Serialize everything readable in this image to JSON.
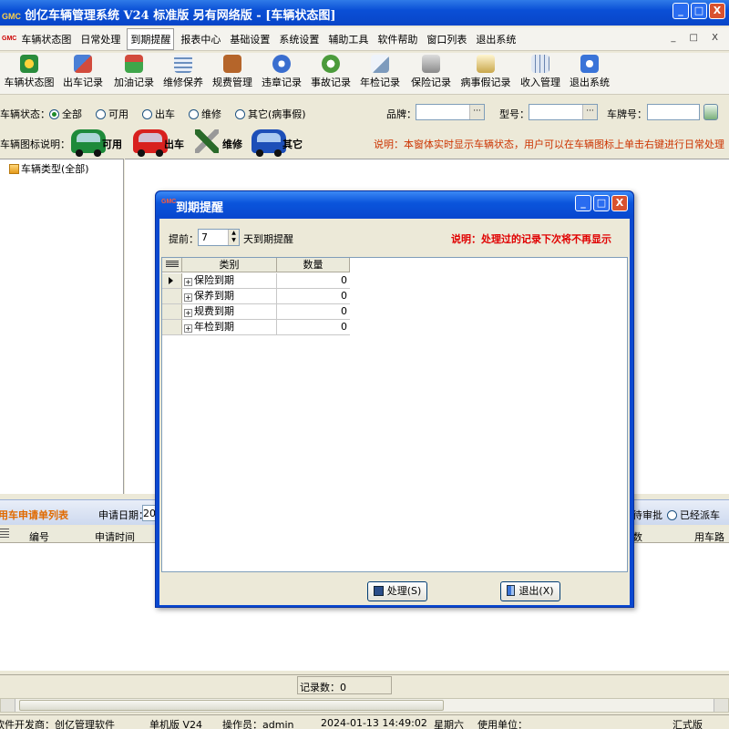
{
  "window": {
    "brand": "GMC",
    "title": "创亿车辆管理系统 V24 标准版 另有网络版 - [车辆状态图]",
    "controls": {
      "minimize": "_",
      "maximize": "□",
      "close": "X"
    }
  },
  "menu": {
    "items": [
      "车辆状态图",
      "日常处理",
      "到期提醒",
      "报表中心",
      "基础设置",
      "系统设置",
      "辅助工具",
      "软件帮助",
      "窗口列表",
      "退出系统"
    ],
    "active": "到期提醒",
    "mdi_controls": "_ □ X"
  },
  "toolbar": {
    "items": [
      {
        "label": "车辆状态图",
        "icon": "car-status-icon",
        "color": "#2a8c3c"
      },
      {
        "label": "出车记录",
        "icon": "dispatch-icon",
        "color": "#4a7fd6"
      },
      {
        "label": "加油记录",
        "icon": "fuel-icon",
        "color": "#d24b3c"
      },
      {
        "label": "维修保养",
        "icon": "maintenance-icon",
        "color": "#6b8fbf"
      },
      {
        "label": "规费管理",
        "icon": "fee-icon",
        "color": "#b5652a"
      },
      {
        "label": "违章记录",
        "icon": "violation-icon",
        "color": "#3a6ecf"
      },
      {
        "label": "事故记录",
        "icon": "accident-icon",
        "color": "#4b9b3b"
      },
      {
        "label": "年检记录",
        "icon": "inspection-icon",
        "color": "#7d9bbd"
      },
      {
        "label": "保险记录",
        "icon": "insurance-icon",
        "color": "#8a8a8a"
      },
      {
        "label": "病事假记录",
        "icon": "leave-icon",
        "color": "#c9a74b"
      },
      {
        "label": "收入管理",
        "icon": "income-icon",
        "color": "#6a85b0"
      },
      {
        "label": "退出系统",
        "icon": "exit-icon",
        "color": "#3a74d8"
      }
    ]
  },
  "filter": {
    "status_label": "车辆状态：",
    "options": [
      "全部",
      "可用",
      "出车",
      "维修",
      "其它(病事假)"
    ],
    "selected": "全部",
    "brand_label": "品牌：",
    "model_label": "型号：",
    "plate_label": "车牌号：",
    "dropdown_glyph": "···"
  },
  "legend": {
    "label": "车辆图标说明：",
    "items": [
      {
        "label": "可用",
        "color": "#1e8a3a"
      },
      {
        "label": "出车",
        "color": "#d8201e"
      },
      {
        "label": "维修",
        "color": "#2a6a2a"
      },
      {
        "label": "其它",
        "color": "#1d4fb8"
      }
    ],
    "note": "说明：本窗体实时显示车辆状态，用户可以在车辆图标上单击右键进行日常处理",
    "note_color": "#cc3300"
  },
  "tree": {
    "root": "车辆类型(全部)"
  },
  "lower": {
    "title": "用车申请单列表",
    "date_label": "申请日期：",
    "date_value": "202",
    "radio_pending": "待审批",
    "radio_done": "已经派车",
    "columns": [
      "编号",
      "申请时间",
      "数",
      "用车路"
    ],
    "record_count": "记录数：0"
  },
  "status_bar": {
    "developer": "软件开发商：创亿管理软件",
    "edition": "单机版 V24",
    "operator": "操作员：admin",
    "datetime": "2024-01-13 14:49:02",
    "weekday": "星期六",
    "unit": "使用单位：",
    "version": "汇式版"
  },
  "dialog": {
    "title": "到期提醒",
    "advance_label": "提前：",
    "advance_value": "7",
    "advance_suffix": "天到期提醒",
    "note": "说明：处理过的记录下次将不再显示",
    "note_color": "#e00000",
    "columns": [
      "类别",
      "数量"
    ],
    "rows": [
      {
        "category": "保险到期",
        "count": "0"
      },
      {
        "category": "保养到期",
        "count": "0"
      },
      {
        "category": "规费到期",
        "count": "0"
      },
      {
        "category": "年检到期",
        "count": "0"
      }
    ],
    "process_button": "处理(S)",
    "exit_button": "退出(X)"
  }
}
